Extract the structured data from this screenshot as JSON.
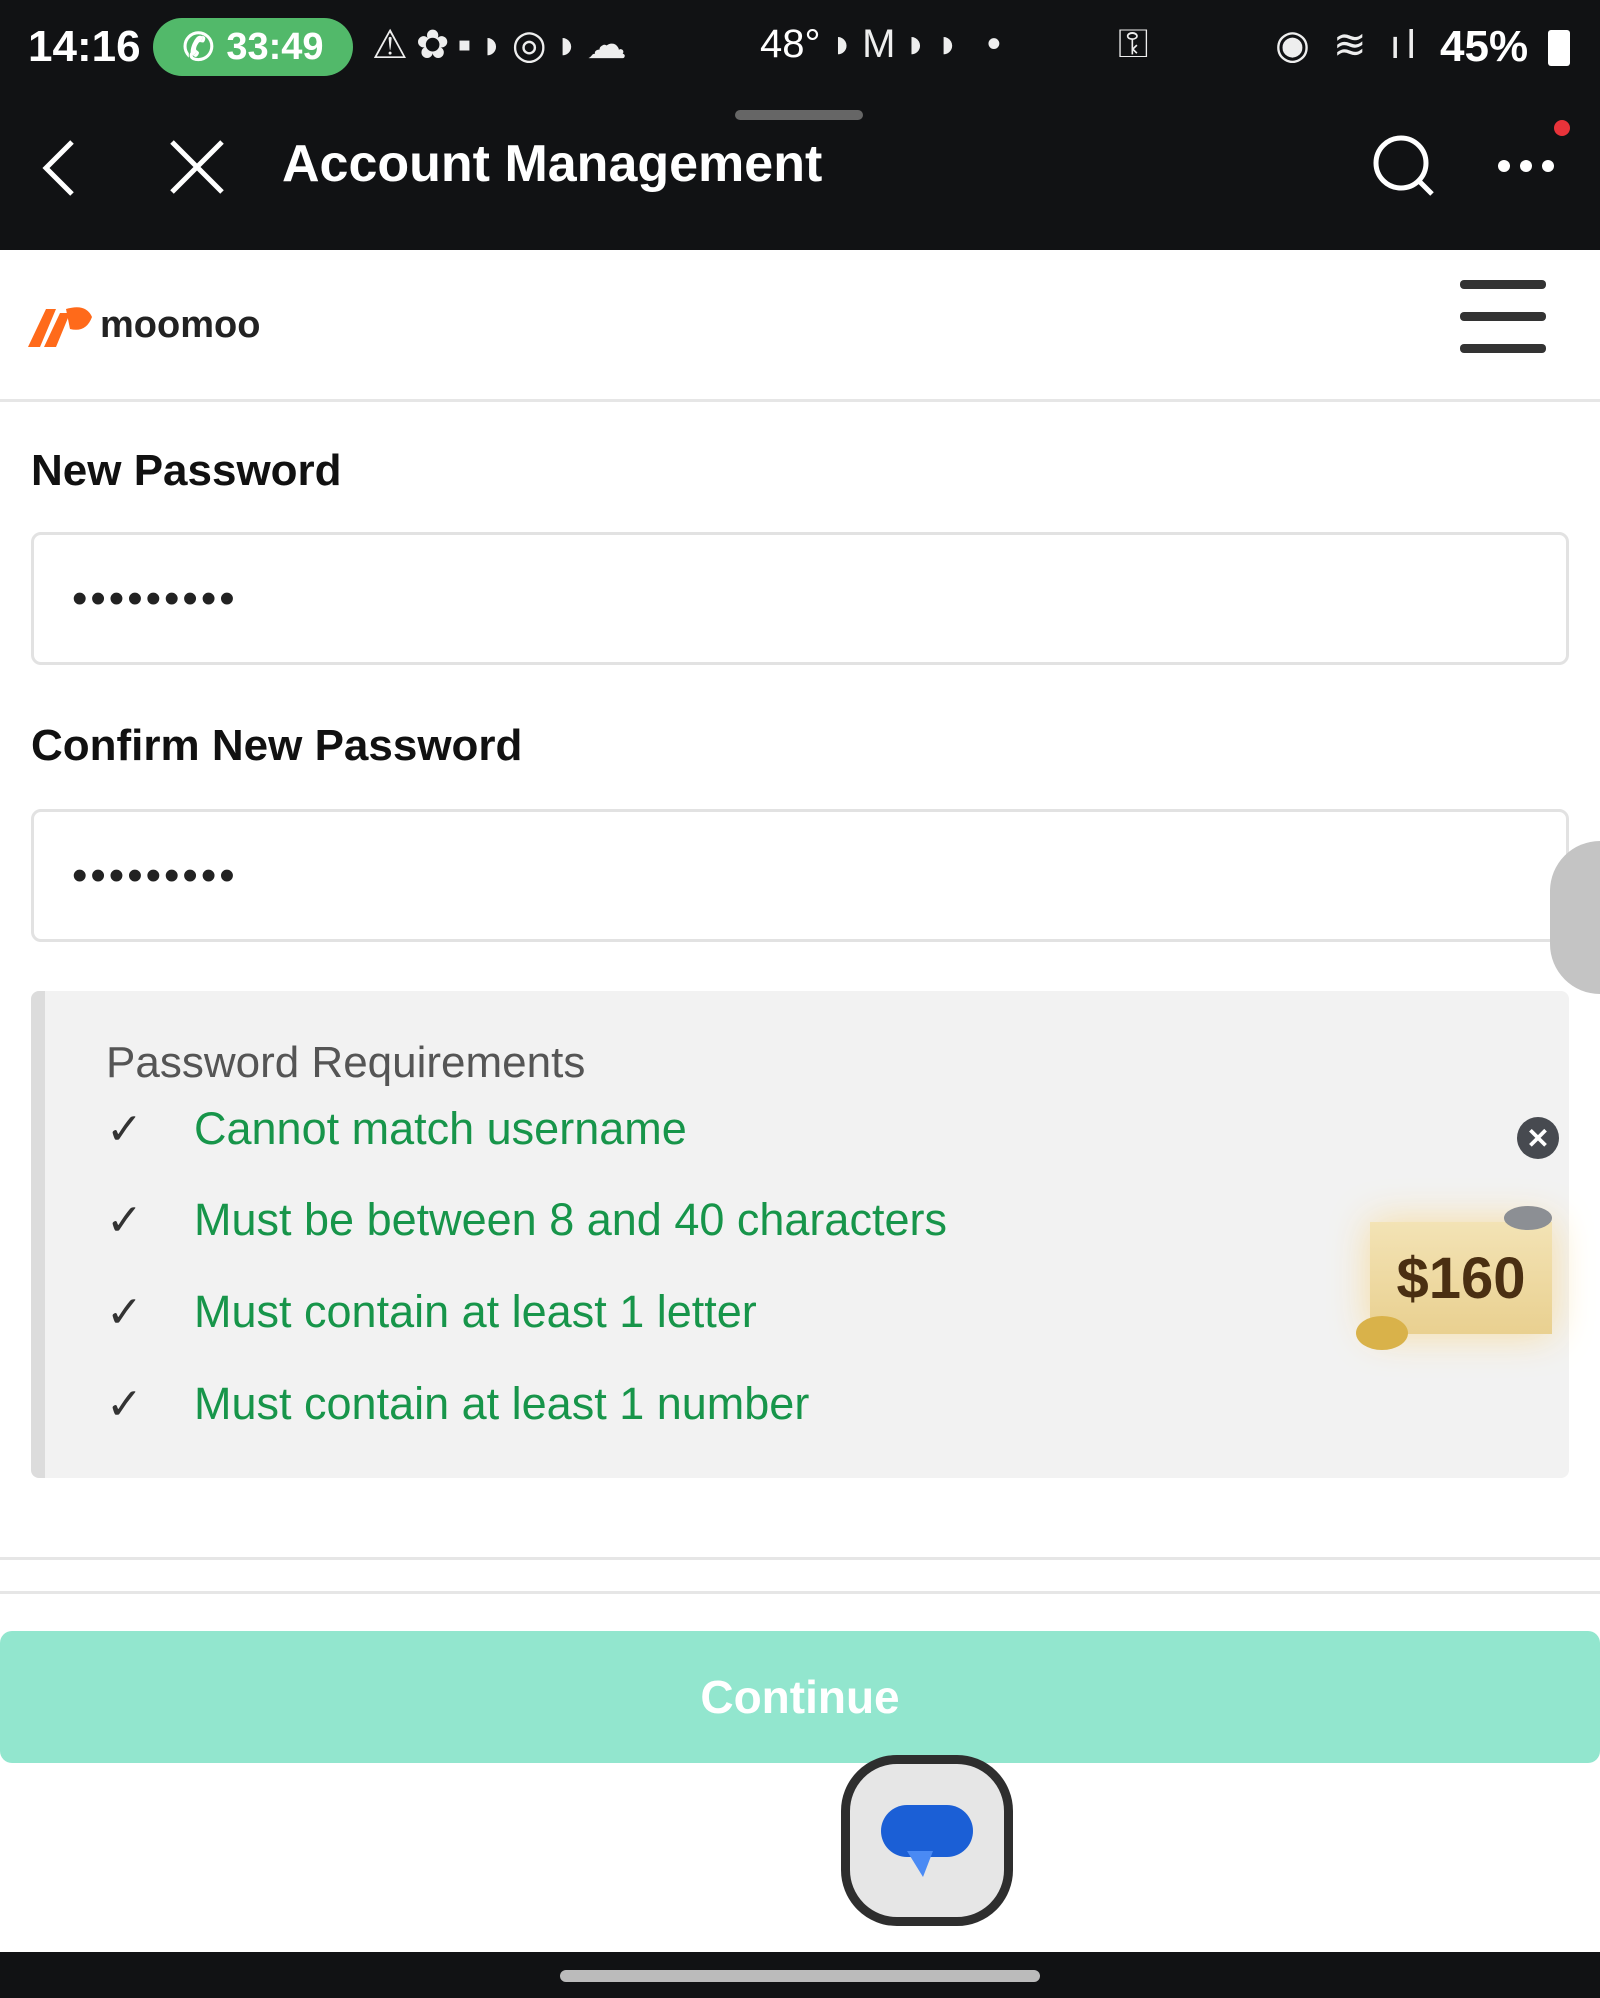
{
  "status_bar": {
    "time": "14:16",
    "call_timer": "33:49",
    "weather": "48°",
    "battery": "45%"
  },
  "header": {
    "title": "Account Management",
    "back_icon": "chevron-left-icon",
    "close_icon": "close-icon",
    "search_icon": "search-icon",
    "more_icon": "more-icon",
    "notification_color": "#e8333a"
  },
  "site": {
    "brand": "moomoo",
    "brand_color": "#ff6a1a"
  },
  "form": {
    "new_password_label": "New Password",
    "new_password_value": "•••••••••",
    "confirm_password_label": "Confirm New Password",
    "confirm_password_value": "•••••••••"
  },
  "requirements": {
    "title": "Password Requirements",
    "items": [
      {
        "text": "Cannot match username",
        "met": true
      },
      {
        "text": "Must be between 8 and 40 characters",
        "met": true
      },
      {
        "text": "Must contain at least 1 letter",
        "met": true
      },
      {
        "text": "Must contain at least 1 number",
        "met": true
      }
    ]
  },
  "promo": {
    "amount": "$160"
  },
  "continue_label": "Continue",
  "colors": {
    "accent": "#92e6ce",
    "success": "#17954a"
  }
}
